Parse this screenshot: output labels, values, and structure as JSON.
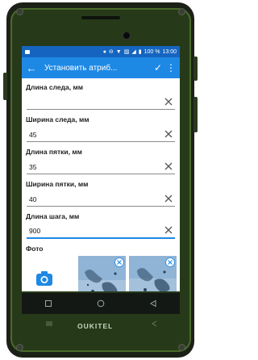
{
  "status_bar": {
    "battery": "100 %",
    "time": "13:00"
  },
  "app_bar": {
    "title": "Установить атриб...",
    "back_icon": "arrow-back-icon",
    "confirm_icon": "check-icon",
    "more_icon": "more-vert-icon"
  },
  "fields": [
    {
      "label": "Длина следа, мм",
      "value": ""
    },
    {
      "label": "Ширина следа, мм",
      "value": "45"
    },
    {
      "label": "Длина пятки, мм",
      "value": "35"
    },
    {
      "label": "Ширина пятки, мм",
      "value": "40"
    },
    {
      "label": "Длина шага, мм",
      "value": "900"
    }
  ],
  "photos": {
    "label": "Фото",
    "camera_icon": "camera-icon",
    "thumbnail_count": 2
  },
  "device": {
    "brand": "OUKITEL"
  },
  "colors": {
    "status_bar": "#1565c0",
    "app_bar": "#1e88e5",
    "accent": "#1e88e5",
    "phone_green": "#4b6b2a"
  }
}
